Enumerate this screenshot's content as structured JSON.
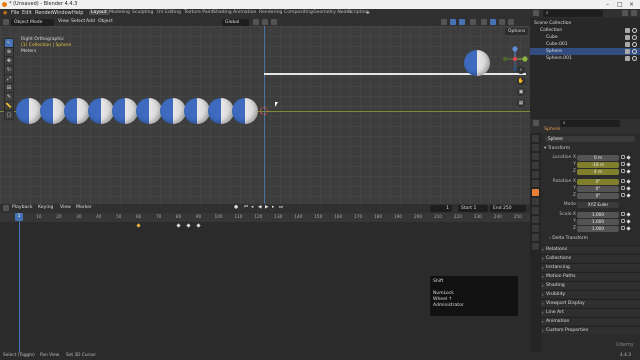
{
  "titlebar": {
    "title": "* (Unsaved) - Blender 4.4.3"
  },
  "topbar": {
    "menus": [
      "File",
      "Edit",
      "Render",
      "Window",
      "Help"
    ],
    "workspaces": [
      "Layout",
      "Modeling",
      "Sculpting",
      "UV Editing",
      "Texture Paint",
      "Shading",
      "Animation",
      "Rendering",
      "Compositing",
      "Geometry Nodes",
      "Scripting"
    ],
    "scene": "Scene",
    "view_layer": "ViewLayer"
  },
  "viewport": {
    "mode": "Object Mode",
    "menus": [
      "View",
      "Select",
      "Add",
      "Object"
    ],
    "orientation": "Global",
    "options": "Options",
    "view_name": "Right Orthographic",
    "collection_info": "(1) Collection | Sphere",
    "units": "Meters"
  },
  "sphere_count": 10,
  "timeline": {
    "menus": [
      "Playback",
      "Keying",
      "View",
      "Marker"
    ],
    "current_frame": "1",
    "start_label": "Start",
    "start": "1",
    "end_label": "End",
    "end": "250",
    "ticks": [
      "0",
      "10",
      "20",
      "30",
      "40",
      "50",
      "60",
      "70",
      "80",
      "90",
      "100",
      "110",
      "120",
      "130",
      "140",
      "150",
      "160",
      "170",
      "180",
      "190",
      "200",
      "210",
      "220",
      "230",
      "240",
      "250"
    ],
    "keyframes": [
      60,
      80,
      85,
      90
    ]
  },
  "popup": {
    "lines": [
      "Shift",
      "",
      "NumLock",
      "Wheel ↑",
      "Administrator"
    ]
  },
  "status": {
    "items": [
      "Select (Toggle)",
      "Pan View",
      "Set 3D Cursor"
    ],
    "version": "4.4.3"
  },
  "outliner": {
    "search": "",
    "rows": [
      {
        "label": "Scene Collection",
        "indent": 0,
        "selected": false
      },
      {
        "label": "Collection",
        "indent": 1,
        "selected": false
      },
      {
        "label": "Cube",
        "indent": 2,
        "selected": false
      },
      {
        "label": "Cube.001",
        "indent": 2,
        "selected": false
      },
      {
        "label": "Sphere",
        "indent": 2,
        "selected": true
      },
      {
        "label": "Sphere.001",
        "indent": 2,
        "selected": false
      }
    ]
  },
  "properties": {
    "object_name": "Sphere",
    "data_name": "Sphere",
    "transform_label": "Transform",
    "location": {
      "label": "Location X",
      "x": "0 m",
      "y": "-16 m",
      "z": "4 m",
      "y_label": "Y",
      "z_label": "Z"
    },
    "rotation": {
      "label": "Rotation X",
      "x": "0°",
      "y": "0°",
      "z": "0°",
      "y_label": "Y",
      "z_label": "Z"
    },
    "mode": {
      "label": "Mode",
      "value": "XYZ Euler"
    },
    "scale": {
      "label": "Scale X",
      "x": "1.000",
      "y": "1.000",
      "z": "1.000",
      "y_label": "Y",
      "z_label": "Z"
    },
    "delta_label": "Delta Transform",
    "panels": [
      "Relations",
      "Collections",
      "Instancing",
      "Motion Paths",
      "Shading",
      "Visibility",
      "Viewport Display",
      "Line Art",
      "Animation",
      "Custom Properties"
    ]
  },
  "watermark": "Udemy"
}
